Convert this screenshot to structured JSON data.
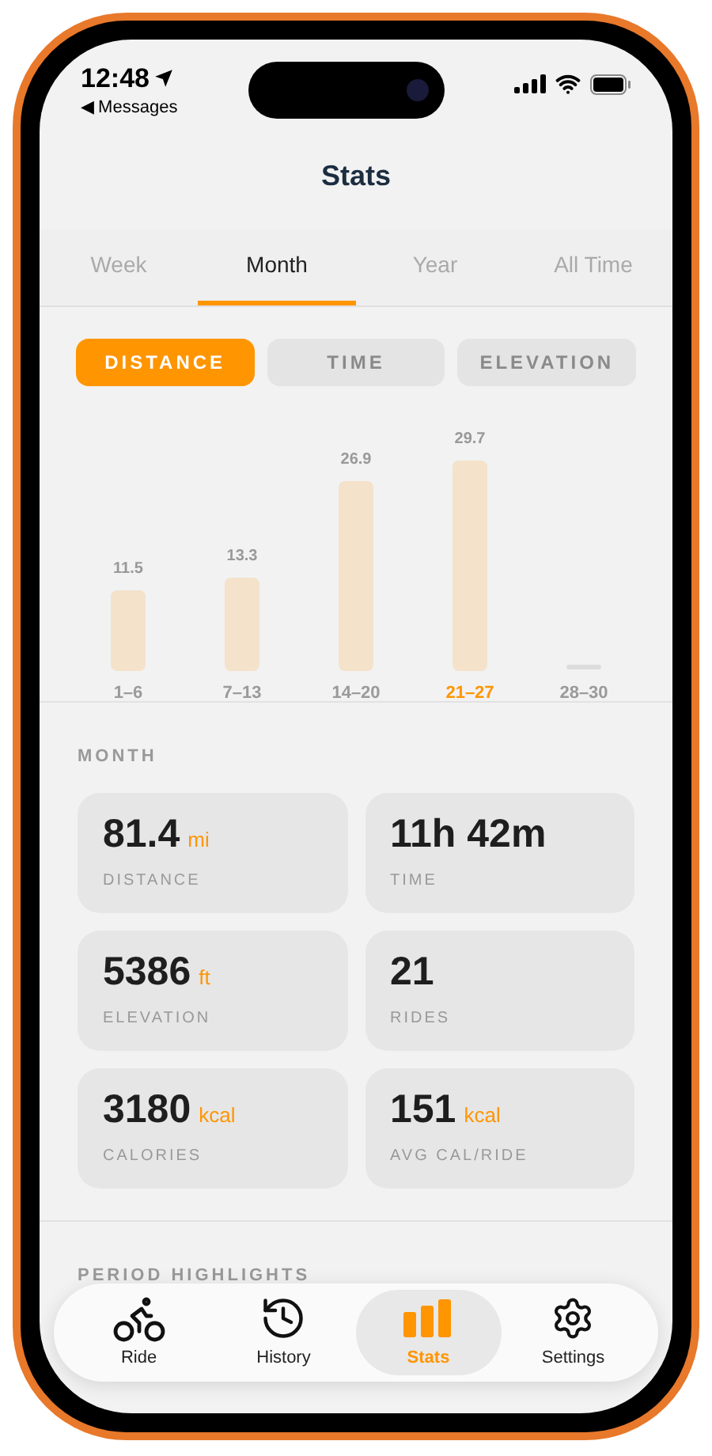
{
  "status_bar": {
    "time": "12:48",
    "back_label": "◀ Messages"
  },
  "title": "Stats",
  "period_tabs": [
    {
      "label": "Week",
      "selected": false
    },
    {
      "label": "Month",
      "selected": true
    },
    {
      "label": "Year",
      "selected": false
    },
    {
      "label": "All Time",
      "selected": false
    }
  ],
  "metric_buttons": [
    {
      "label": "DISTANCE",
      "selected": true
    },
    {
      "label": "TIME",
      "selected": false
    },
    {
      "label": "ELEVATION",
      "selected": false
    }
  ],
  "chart": {
    "chart_data": {
      "type": "bar",
      "categories": [
        "1–6",
        "7–13",
        "14–20",
        "21–27",
        "28–30"
      ],
      "values": [
        11.5,
        13.3,
        26.9,
        29.7,
        null
      ],
      "ylim": [
        0,
        30
      ],
      "value_labels": [
        "11.5",
        "13.3",
        "26.9",
        "29.7",
        null
      ]
    },
    "highlighted": [
      false,
      false,
      false,
      true,
      false
    ]
  },
  "section_title": "MONTH",
  "stat_cards": [
    {
      "value": "81.4",
      "unit": "mi",
      "label": "DISTANCE"
    },
    {
      "value": "11h 42m",
      "label": "TIME"
    },
    {
      "value": "5386",
      "unit": "ft",
      "label": "ELEVATION"
    },
    {
      "value": "21",
      "label": "RIDES"
    },
    {
      "value": "3180",
      "unit": "kcal",
      "label": "CALORIES"
    },
    {
      "value": "151",
      "unit": "kcal",
      "label": "AVG CAL/RIDE"
    }
  ],
  "highlights_title": "PERIOD HIGHLIGHTS",
  "tab_bar": [
    {
      "kind": "bike",
      "label": "Ride",
      "selected": false
    },
    {
      "kind": "history",
      "label": "History",
      "selected": false
    },
    {
      "kind": "stats",
      "label": "Stats",
      "selected": true
    },
    {
      "kind": "settings",
      "label": "Settings",
      "selected": false
    }
  ]
}
